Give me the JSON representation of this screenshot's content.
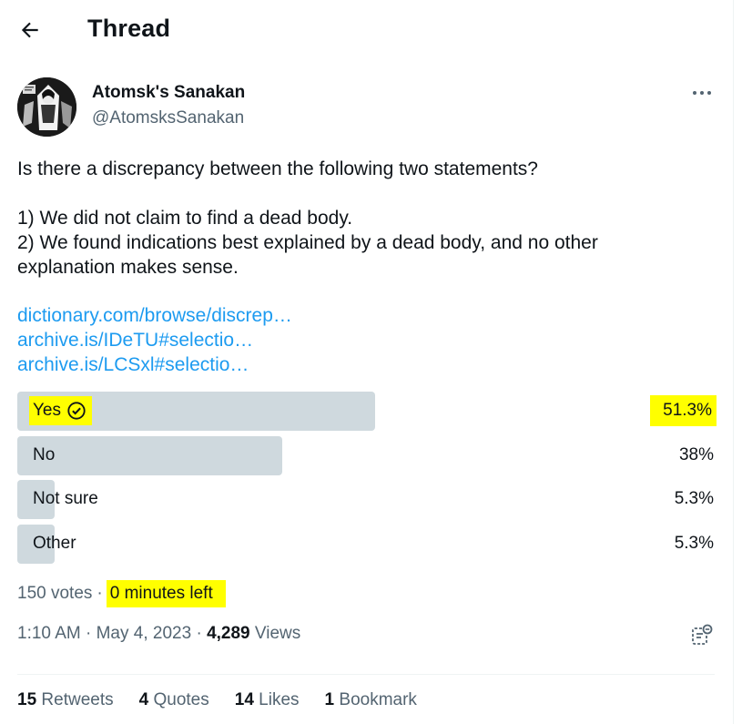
{
  "header": {
    "title": "Thread"
  },
  "author": {
    "name": "Atomsk's Sanakan",
    "handle": "@AtomsksSanakan"
  },
  "tweet": {
    "lines": [
      "Is there a discrepancy between the following two statements?",
      "1) We did not claim to find a dead body.",
      "2) We found indications best explained by a dead body, and no other",
      "explanation makes sense."
    ],
    "links": [
      "dictionary.com/browse/discrep…",
      "archive.is/IDeTU#selectio…",
      "archive.is/LCSxl#selectio…"
    ]
  },
  "poll": {
    "options": [
      {
        "label": "Yes",
        "percent": "51.3%",
        "share": 0.513,
        "winner": true
      },
      {
        "label": "No",
        "percent": "38%",
        "share": 0.38,
        "winner": false
      },
      {
        "label": "Not sure",
        "percent": "5.3%",
        "share": 0.053,
        "winner": false
      },
      {
        "label": "Other",
        "percent": "5.3%",
        "share": 0.053,
        "winner": false
      }
    ],
    "votes": "150 votes",
    "separator": "·",
    "time_left": "0 minutes left"
  },
  "meta": {
    "time": "1:10 AM",
    "sep1": "·",
    "date": "May 4, 2023",
    "sep2": "·",
    "views_count": "4,289",
    "views_label": "Views"
  },
  "stats": {
    "retweets_count": "15",
    "retweets_label": "Retweets",
    "quotes_count": "4",
    "quotes_label": "Quotes",
    "likes_count": "14",
    "likes_label": "Likes",
    "bookmarks_count": "1",
    "bookmarks_label": "Bookmark"
  },
  "colors": {
    "highlight": "#ffff00",
    "link": "#1d9bf0",
    "poll_bar": "#cfd9de",
    "secondary_text": "#536471"
  },
  "icons": {
    "back": "arrow-left-icon",
    "more": "more-horizontal-icon",
    "check": "check-circle-icon",
    "analytics": "analytics-icon"
  }
}
